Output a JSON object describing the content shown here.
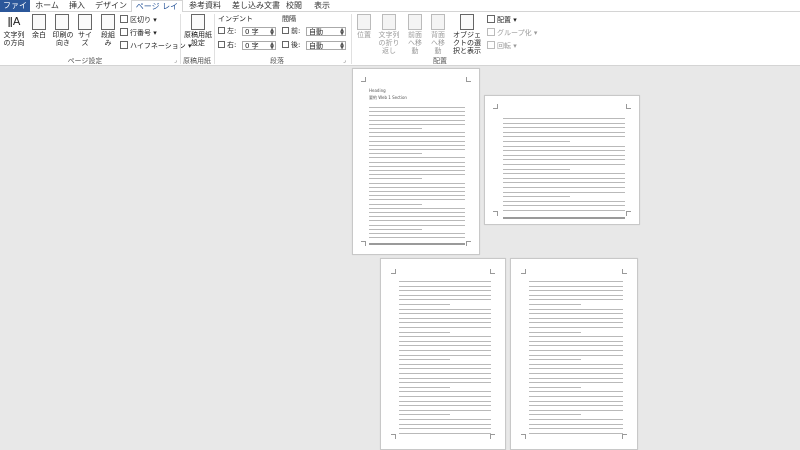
{
  "tabs": [
    {
      "id": "file",
      "label": "ファイル"
    },
    {
      "id": "home",
      "label": "ホーム"
    },
    {
      "id": "insert",
      "label": "挿入"
    },
    {
      "id": "design",
      "label": "デザイン"
    },
    {
      "id": "layout",
      "label": "ページ レイアウト"
    },
    {
      "id": "references",
      "label": "参考資料"
    },
    {
      "id": "mailings",
      "label": "差し込み文書"
    },
    {
      "id": "review",
      "label": "校閲"
    },
    {
      "id": "view",
      "label": "表示"
    }
  ],
  "ribbon": {
    "page_setup": {
      "label": "ページ設定",
      "text_direction": "文字列の方向",
      "margins": "余白",
      "orientation": "印刷の向き",
      "size": "サイズ",
      "columns": "段組み",
      "breaks": "区切り",
      "line_numbers": "行番号",
      "hyphenation": "ハイフネーション"
    },
    "manuscript": {
      "label": "原稿用紙",
      "settings": "原稿用紙設定"
    },
    "paragraph": {
      "label": "段落",
      "indent_header": "インデント",
      "spacing_header": "間隔",
      "left_label": "左:",
      "left_value": "0 字",
      "right_label": "右:",
      "right_value": "0 字",
      "before_label": "前:",
      "before_value": "自動",
      "after_label": "後:",
      "after_value": "自動"
    },
    "arrange": {
      "label": "配置",
      "position": "位置",
      "wrap_text": "文字列の折り返し",
      "bring_forward": "前面へ移動",
      "send_backward": "背面へ移動",
      "selection_pane": "オブジェクトの選択と表示",
      "align": "配置",
      "group": "グループ化",
      "rotate": "回転"
    }
  },
  "document": {
    "page1_title": "Heading",
    "page1_subtitle": "要約 Web 1 Section"
  }
}
